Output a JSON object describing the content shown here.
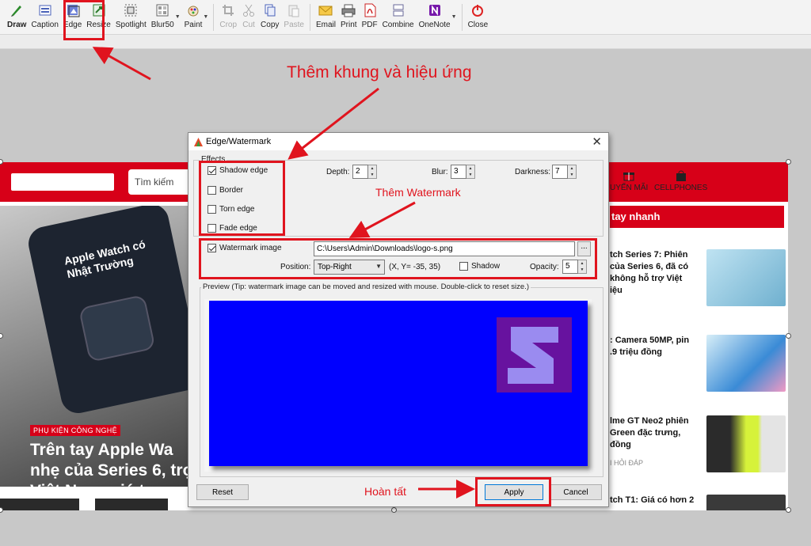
{
  "toolbar": {
    "items": [
      {
        "label": "Draw",
        "icon": "draw-icon"
      },
      {
        "label": "Caption",
        "icon": "caption-icon"
      },
      {
        "label": "Edge",
        "icon": "edge-icon"
      },
      {
        "label": "Resize",
        "icon": "resize-icon"
      },
      {
        "label": "Spotlight",
        "icon": "spotlight-icon"
      },
      {
        "label": "Blur50",
        "icon": "blur-icon"
      },
      {
        "label": "Paint",
        "icon": "paint-icon"
      },
      {
        "label": "Crop",
        "icon": "crop-icon"
      },
      {
        "label": "Cut",
        "icon": "cut-icon"
      },
      {
        "label": "Copy",
        "icon": "copy-icon"
      },
      {
        "label": "Paste",
        "icon": "paste-icon"
      },
      {
        "label": "Email",
        "icon": "email-icon"
      },
      {
        "label": "Print",
        "icon": "print-icon"
      },
      {
        "label": "PDF",
        "icon": "pdf-icon"
      },
      {
        "label": "Combine",
        "icon": "combine-icon"
      },
      {
        "label": "OneNote",
        "icon": "onenote-icon"
      },
      {
        "label": "Close",
        "icon": "power-icon"
      }
    ]
  },
  "website": {
    "search_placeholder": "Tìm kiếm",
    "hero_tag": "PHỤ KIỆN CÔNG NGHỆ",
    "hero_title": "Trên tay Apple Wa nhẹ của Series 6, trợ Việt Nam, giá t",
    "phone_screen_text": "Apple Watch có Nhật Trường",
    "right_nav": {
      "promo_label": "UYẾN MÃI",
      "stores_label": "CELLPHONES"
    },
    "section_title": "tay nhanh",
    "news": [
      {
        "title": "tch Series 7: Phiên của Series 6, đã có không hỗ trợ Việt iệu",
        "sub": ""
      },
      {
        "title": ": Camera 50MP, pin .9 triệu đồng",
        "sub": ""
      },
      {
        "title": "lme GT Neo2 phiên Green đặc trưng, đồng",
        "sub": "I HỎI ĐÁP"
      },
      {
        "title": "tch T1: Giá có hơn 2",
        "sub": ""
      }
    ]
  },
  "dialog": {
    "title": "Edge/Watermark",
    "effects_label": "Effects",
    "shadow_edge": {
      "label": "Shadow edge",
      "checked": true
    },
    "border": {
      "label": "Border",
      "checked": false
    },
    "torn_edge": {
      "label": "Torn edge",
      "checked": false
    },
    "fade_edge": {
      "label": "Fade edge",
      "checked": false
    },
    "depth": {
      "label": "Depth:",
      "value": "2"
    },
    "blur": {
      "label": "Blur:",
      "value": "3"
    },
    "darkness": {
      "label": "Darkness:",
      "value": "7"
    },
    "watermark": {
      "label": "Watermark image",
      "checked": true,
      "path": "C:\\Users\\Admin\\Downloads\\logo-s.png",
      "browse_label": "...",
      "position_label": "Position:",
      "position_value": "Top-Right",
      "coords": "(X, Y= -35, 35)",
      "shadow_label": "Shadow",
      "shadow_checked": false,
      "opacity_label": "Opacity:",
      "opacity_value": "5"
    },
    "preview_label": "Preview (Tip: watermark image can be moved and resized with mouse. Double-click to reset size.)",
    "reset_label": "Reset",
    "apply_label": "Apply",
    "cancel_label": "Cancel"
  },
  "annotations": {
    "effects_note": "Thêm khung và hiệu ứng",
    "watermark_note": "Thêm Watermark",
    "done_note": "Hoàn tất"
  },
  "colors": {
    "annotation_red": "#e0141e",
    "preview_blue": "#0000ff",
    "watermark_purple": "#67129f",
    "site_red": "#d70018"
  }
}
